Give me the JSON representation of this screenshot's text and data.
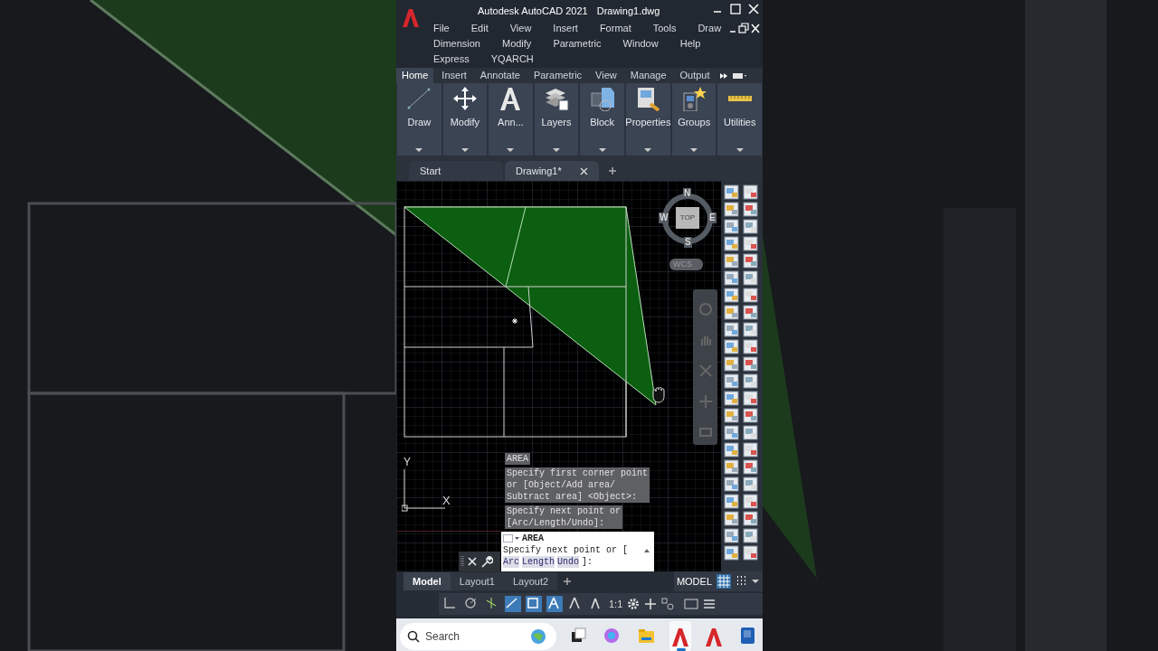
{
  "window": {
    "title": "Autodesk AutoCAD 2021",
    "document": "Drawing1.dwg"
  },
  "menu": [
    "File",
    "Edit",
    "View",
    "Insert",
    "Format",
    "Tools",
    "Draw",
    "Dimension",
    "Modify",
    "Parametric",
    "Window",
    "Help",
    "Express",
    "YQARCH"
  ],
  "ribbon_tabs": [
    {
      "label": "Home",
      "selected": true
    },
    {
      "label": "Insert",
      "selected": false
    },
    {
      "label": "Annotate",
      "selected": false
    },
    {
      "label": "Parametric",
      "selected": false
    },
    {
      "label": "View",
      "selected": false
    },
    {
      "label": "Manage",
      "selected": false
    },
    {
      "label": "Output",
      "selected": false
    }
  ],
  "ribbon_panels": [
    {
      "label": "Draw",
      "kind": "draw"
    },
    {
      "label": "Modify",
      "kind": "modify"
    },
    {
      "label": "Ann...",
      "kind": "annotate"
    },
    {
      "label": "Layers",
      "kind": "layers"
    },
    {
      "label": "Block",
      "kind": "block"
    },
    {
      "label": "Properties",
      "kind": "properties"
    },
    {
      "label": "Groups",
      "kind": "groups"
    },
    {
      "label": "Utilities",
      "kind": "utilities"
    }
  ],
  "file_tabs": [
    {
      "label": "Start",
      "selected": false
    },
    {
      "label": "Drawing1*",
      "selected": true
    }
  ],
  "viewcube": {
    "north": "N",
    "west": "W",
    "east": "E",
    "south": "S",
    "face": "TOP",
    "ucs": "WCS"
  },
  "axes": {
    "y": "Y",
    "x": "X"
  },
  "command_history": [
    {
      "lines": [
        "AREA"
      ]
    },
    {
      "lines": [
        "Specify first corner point",
        "or [Object/Add area/",
        "Subtract area] <Object>:"
      ]
    },
    {
      "lines": [
        "Specify next point or",
        "[Arc/Length/Undo]:"
      ]
    }
  ],
  "command_line": {
    "command": "AREA",
    "prompt": "Specify next point or [",
    "options": [
      "Arc",
      "Length",
      "Undo"
    ],
    "suffix": "]:"
  },
  "layout_tabs": [
    {
      "label": "Model",
      "selected": true
    },
    {
      "label": "Layout1",
      "selected": false
    },
    {
      "label": "Layout2",
      "selected": false
    }
  ],
  "status": {
    "space": "MODEL",
    "scale": "1:1"
  },
  "status_toggles": [
    {
      "kind": "grid",
      "on": true
    },
    {
      "kind": "snap",
      "on": false
    }
  ],
  "drafting_toggles": [
    {
      "kind": "ortho",
      "on": false
    },
    {
      "kind": "polar",
      "on": false
    },
    {
      "kind": "isodraft",
      "on": false
    },
    {
      "kind": "otrack",
      "on": true
    },
    {
      "kind": "osnap",
      "on": true
    },
    {
      "kind": "annovis",
      "on": true
    },
    {
      "kind": "autoscale",
      "on": false
    },
    {
      "kind": "annoscale",
      "on": false
    }
  ],
  "taskbar": {
    "search_placeholder": "Search",
    "apps": [
      {
        "kind": "taskview",
        "selected": false
      },
      {
        "kind": "copilot",
        "selected": false
      },
      {
        "kind": "folder",
        "selected": false
      },
      {
        "kind": "cad",
        "selected": true
      },
      {
        "kind": "cad2",
        "selected": false
      },
      {
        "kind": "revit",
        "selected": false
      }
    ]
  }
}
